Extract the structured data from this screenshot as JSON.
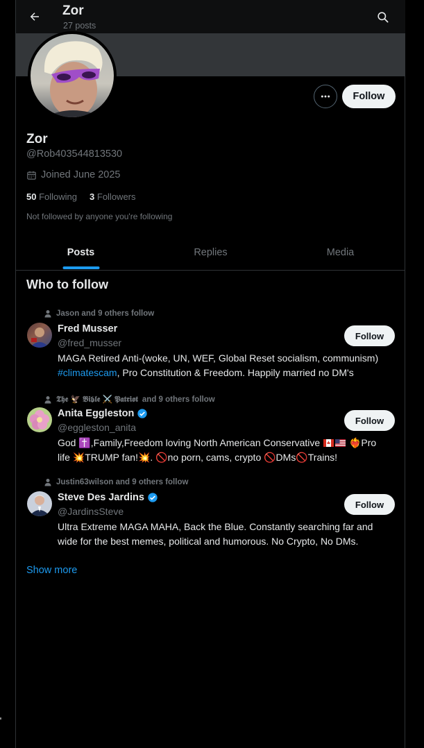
{
  "header": {
    "name": "Zor",
    "post_count": "27 posts"
  },
  "profile": {
    "name": "Zor",
    "handle": "@Rob403544813530",
    "joined": "Joined June 2025",
    "following_count": "50",
    "following_label": "Following",
    "followers_count": "3",
    "followers_label": "Followers",
    "not_followed_note": "Not followed by anyone you're following",
    "follow_label": "Follow"
  },
  "tabs": [
    {
      "label": "Posts",
      "active": true
    },
    {
      "label": "Replies",
      "active": false
    },
    {
      "label": "Media",
      "active": false
    }
  ],
  "who_to_follow": {
    "title": "Who to follow",
    "show_more": "Show more",
    "suggestions": [
      {
        "social_context": "Jason and 9 others follow",
        "name": "Fred Musser",
        "handle": "@fred_musser",
        "verified": false,
        "follow_label": "Follow",
        "bio_line1": "MAGA Retired Anti-(woke, UN, WEF, Global Reset socialism, communism)",
        "bio_hashtag": "#climatescam",
        "bio_line2_rest": ", Pro Constitution & Freedom. Happily married no DM's"
      },
      {
        "social_context_name": "𝕿𝖍𝖊 🦅 𝕭𝖎𝖇𝖑𝖊 ⚔️ 𝕻𝖆𝖙𝖗𝖎𝖔𝖙",
        "social_context_rest": "and 9 others follow",
        "name": "Anita Eggleston",
        "handle": "@eggleston_anita",
        "verified": true,
        "follow_label": "Follow",
        "bio_part1": "God ✝️,Family,Freedom loving North American Conservative",
        "bio_part2": "❤️‍🔥Pro life 💥TRUMP fan!💥. 🚫no porn, cams, crypto 🚫DMs🚫Trains!"
      },
      {
        "social_context": "Justin63wilson and 9 others follow",
        "name": "Steve Des Jardins",
        "handle": "@JardinsSteve",
        "verified": true,
        "follow_label": "Follow",
        "bio": "Ultra Extreme MAGA MAHA, Back the Blue. Constantly searching far and wide for the best memes, political and humorous. No Crypto, No DMs."
      }
    ]
  },
  "colors": {
    "accent": "#1d9bf0",
    "background": "#000000",
    "muted": "#71767b",
    "button_bg": "#eff3f4"
  },
  "icons": [
    "back-arrow-icon",
    "search-icon",
    "more-icon",
    "calendar-icon",
    "person-icon",
    "verified-badge-icon"
  ]
}
